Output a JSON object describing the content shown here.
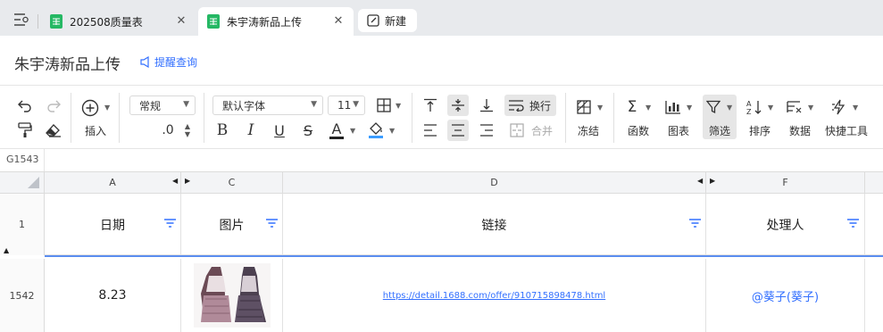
{
  "tabs": [
    {
      "label": "202508质量表",
      "active": false
    },
    {
      "label": "朱宇涛新品上传",
      "active": true
    }
  ],
  "new_tab_label": "新建",
  "doc": {
    "title": "朱宇涛新品上传",
    "remind_label": "提醒查询"
  },
  "toolbar": {
    "insert_label": "插入",
    "number_format": "常规",
    "decimal": ".0",
    "font_family": "默认字体",
    "font_size": "11",
    "wrap_label": "换行",
    "merge_label": "合并",
    "freeze_label": "冻结",
    "function_label": "函数",
    "chart_label": "图表",
    "filter_label": "筛选",
    "sort_label": "排序",
    "data_label": "数据",
    "quick_tools_label": "快捷工具"
  },
  "namebox": "G1543",
  "columns": [
    "A",
    "C",
    "D",
    "F"
  ],
  "header_row": {
    "num": "1",
    "cells": [
      "日期",
      "图片",
      "链接",
      "处理人"
    ]
  },
  "data_row": {
    "num": "1542",
    "date": "8.23",
    "link": "https://detail.1688.com/offer/910715898478.html",
    "handler": "@葵子(葵子)"
  },
  "colors": {
    "accent": "#3370ff",
    "sheet_green": "#25b864",
    "freeze_line": "#5b8def"
  },
  "icons": [
    "menu-icon",
    "sheet-icon",
    "close-icon",
    "edit-icon",
    "bell-icon",
    "undo-icon",
    "redo-icon",
    "format-painter-icon",
    "eraser-icon",
    "plus-circle-icon",
    "bold-icon",
    "italic-icon",
    "underline-icon",
    "strikethrough-icon",
    "font-color-icon",
    "fill-color-icon",
    "border-icon",
    "align-top-icon",
    "align-middle-icon",
    "align-bottom-icon",
    "align-left-icon",
    "align-center-icon",
    "align-right-icon",
    "wrap-icon",
    "merge-icon",
    "freeze-icon",
    "sum-icon",
    "chart-icon",
    "filter-icon",
    "sort-icon",
    "data-icon",
    "quick-tools-icon"
  ]
}
